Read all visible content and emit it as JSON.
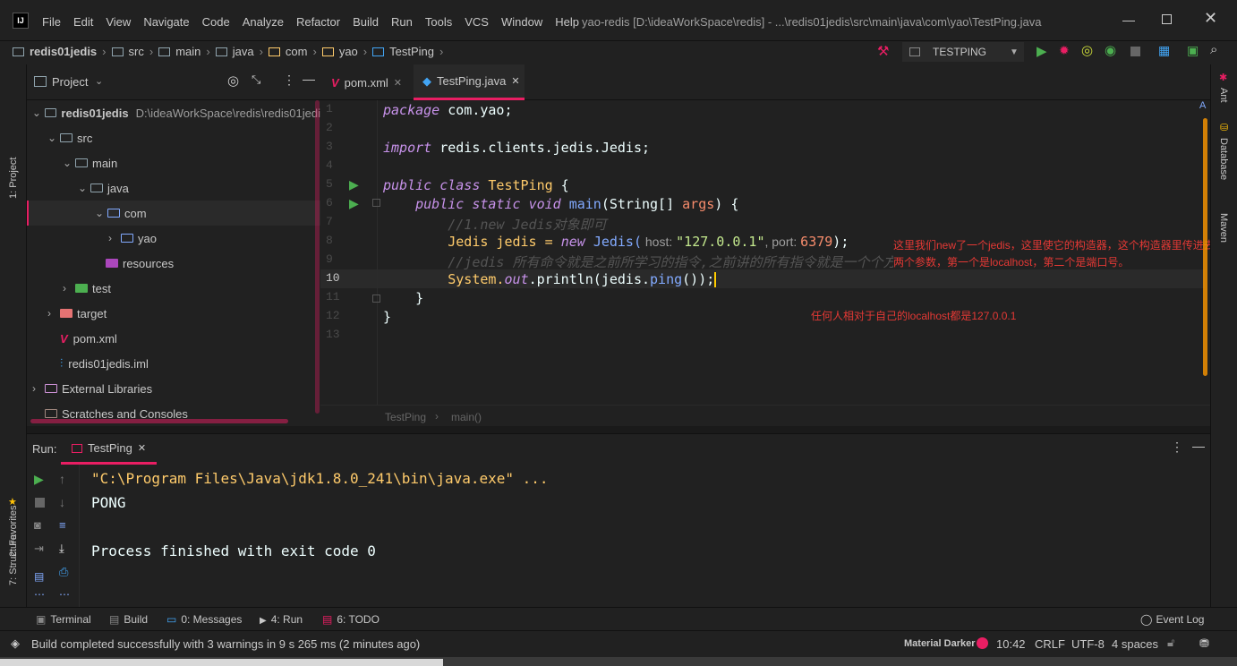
{
  "window": {
    "title": "yao-redis [D:\\ideaWorkSpace\\redis] - ...\\redis01jedis\\src\\main\\java\\com\\yao\\TestPing.java"
  },
  "menu": [
    "File",
    "Edit",
    "View",
    "Navigate",
    "Code",
    "Analyze",
    "Refactor",
    "Build",
    "Run",
    "Tools",
    "VCS",
    "Window",
    "Help"
  ],
  "breadcrumb": [
    "redis01jedis",
    "src",
    "main",
    "java",
    "com",
    "yao",
    "TestPing"
  ],
  "run_config": "TESTPING",
  "project_panel": {
    "title": "Project",
    "tree": [
      {
        "label": "redis01jedis",
        "extra": "D:\\ideaWorkSpace\\redis\\redis01jedi",
        "depth": 0,
        "arrow": "⌄"
      },
      {
        "label": "src",
        "depth": 1,
        "arrow": "⌄"
      },
      {
        "label": "main",
        "depth": 2,
        "arrow": "⌄"
      },
      {
        "label": "java",
        "depth": 3,
        "arrow": "⌄"
      },
      {
        "label": "com",
        "depth": 4,
        "arrow": "⌄"
      },
      {
        "label": "yao",
        "depth": 5,
        "arrow": "›"
      },
      {
        "label": "resources",
        "depth": 4,
        "arrow": ""
      },
      {
        "label": "test",
        "depth": 2,
        "arrow": "›"
      },
      {
        "label": "target",
        "depth": 1,
        "arrow": "›"
      },
      {
        "label": "pom.xml",
        "depth": 1,
        "arrow": ""
      },
      {
        "label": "redis01jedis.iml",
        "depth": 1,
        "arrow": ""
      },
      {
        "label": "External Libraries",
        "depth": 0,
        "arrow": "›"
      },
      {
        "label": "Scratches and Consoles",
        "depth": 0,
        "arrow": ""
      }
    ]
  },
  "editor": {
    "tabs": [
      "pom.xml",
      "TestPing.java"
    ],
    "lines": [
      "1",
      "2",
      "3",
      "4",
      "5",
      "6",
      "7",
      "8",
      "9",
      "10",
      "11",
      "12",
      "13"
    ],
    "code": {
      "l1_kw": "package",
      "l1_rest": " com.yao;",
      "l3_kw": "import",
      "l3_rest": " redis.clients.jedis.Jedis;",
      "l5_a": "public",
      "l5_b": "class",
      "l5_c": "TestPing",
      "l5_d": " {",
      "l6_a": "public",
      "l6_b": "static",
      "l6_c": "void",
      "l6_d": "main",
      "l6_e": "(String[] ",
      "l6_f": "args",
      "l6_g": ") {",
      "l7": "//1.new Jedis对象即可",
      "l8_a": "Jedis jedis = ",
      "l8_b": "new",
      "l8_c": "Jedis(",
      "l8_d": " host: ",
      "l8_e": "\"127.0.0.1\"",
      "l8_f": ", port: ",
      "l8_g": "6379",
      "l8_h": ");",
      "l9": "//jedis 所有命令就是之前所学习的指令,之前讲的所有指令就是一个个方法,",
      "l10_a": "System.",
      "l10_b": "out",
      "l10_c": ".println(jedis.",
      "l10_d": "ping",
      "l10_e": "());",
      "l11": "}",
      "l12": "}"
    },
    "footer_crumb": [
      "TestPing",
      "main()"
    ],
    "annotations": [
      "这里我们new了一个jedis，这里使它的构造器，这个构造器里传进去的",
      "两个参数，第一个是localhost，第二个是端口号。",
      "任何人相对于自己的localhost都是127.0.0.1"
    ]
  },
  "run_panel": {
    "label": "Run:",
    "tab": "TestPing",
    "output": [
      "\"C:\\Program Files\\Java\\jdk1.8.0_241\\bin\\java.exe\" ...",
      "PONG",
      "",
      "Process finished with exit code 0"
    ]
  },
  "bottom_tabs": [
    "Terminal",
    "Build",
    "0: Messages",
    "4: Run",
    "6: TODO"
  ],
  "event_log": "Event Log",
  "left_strip": [
    "1: Project",
    "2: Favorites",
    "7: Structure"
  ],
  "right_strip": [
    "Ant",
    "Database",
    "Maven"
  ],
  "status": {
    "message": "Build completed successfully with 3 warnings in 9 s 265 ms (2 minutes ago)",
    "theme": "Material Darker",
    "position": "10:42",
    "line_sep": "CRLF",
    "encoding": "UTF-8",
    "indent": "4 spaces"
  },
  "colors": {
    "accent": "#e91e63",
    "run_green": "#4caf50"
  }
}
